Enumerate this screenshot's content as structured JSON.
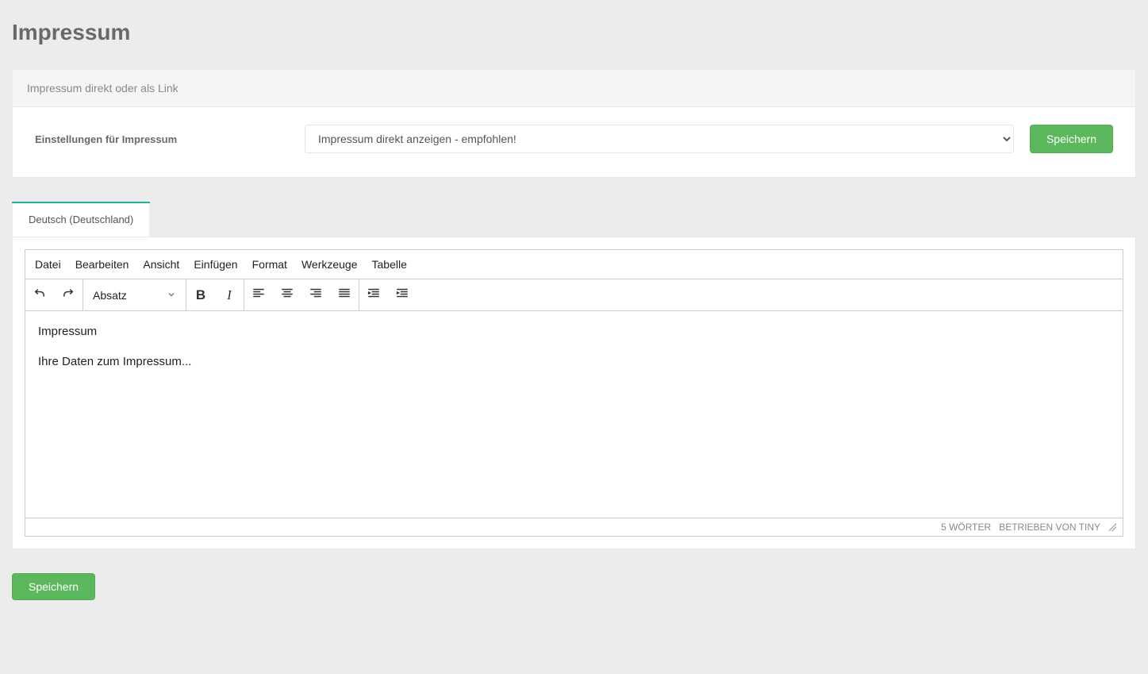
{
  "page": {
    "title": "Impressum"
  },
  "panel": {
    "header": "Impressum direkt oder als Link",
    "settingsLabel": "Einstellungen für Impressum",
    "selectValue": "Impressum direkt anzeigen - empfohlen!",
    "saveLabel": "Speichern"
  },
  "tabs": {
    "active": "Deutsch (Deutschland)"
  },
  "editor": {
    "menubar": [
      "Datei",
      "Bearbeiten",
      "Ansicht",
      "Einfügen",
      "Format",
      "Werkzeuge",
      "Tabelle"
    ],
    "blockFormat": "Absatz",
    "content": {
      "line1": "Impressum",
      "line2": "Ihre Daten zum Impressum..."
    },
    "status": {
      "words": "5 WÖRTER",
      "poweredBy": "BETRIEBEN VON TINY"
    }
  },
  "bottom": {
    "saveLabel": "Speichern"
  }
}
